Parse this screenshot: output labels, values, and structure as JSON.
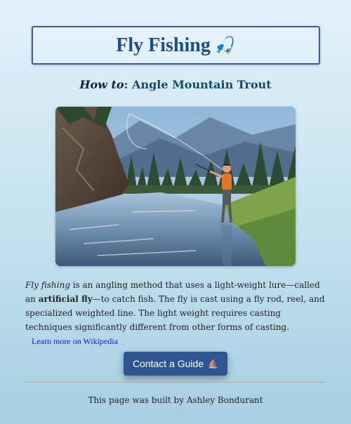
{
  "header": {
    "title": "Fly Fishing",
    "title_icon": "fishing-pole-icon",
    "title_emoji": "🎣"
  },
  "subtitle": {
    "prefix": "How to",
    "separator": ": ",
    "text": "Angle Mountain Trout"
  },
  "photo": {
    "subject": "angler casting a fly rod while wading in a mountain river"
  },
  "description": {
    "term": "Fly fishing",
    "part1": " is an angling method that uses a light-weight lure—called an ",
    "bold_term": "artificial fly",
    "part2": "—to catch fish. The fly is cast using a fly rod, reel, and specialized weighted line. The light weight requires casting techniques significantly different from other forms of casting."
  },
  "link": {
    "label": "Learn more on Wikipedia"
  },
  "contact_button": {
    "label": "Contact a Guide",
    "emoji": "⛵",
    "icon": "sailboat-icon"
  },
  "footer": {
    "text": "This page was built by Ashley Bondurant"
  },
  "colors": {
    "title": "#1c4d86",
    "title_border": "#3d5aa8",
    "button": "#2c5591",
    "link": "#1a1ad6"
  }
}
